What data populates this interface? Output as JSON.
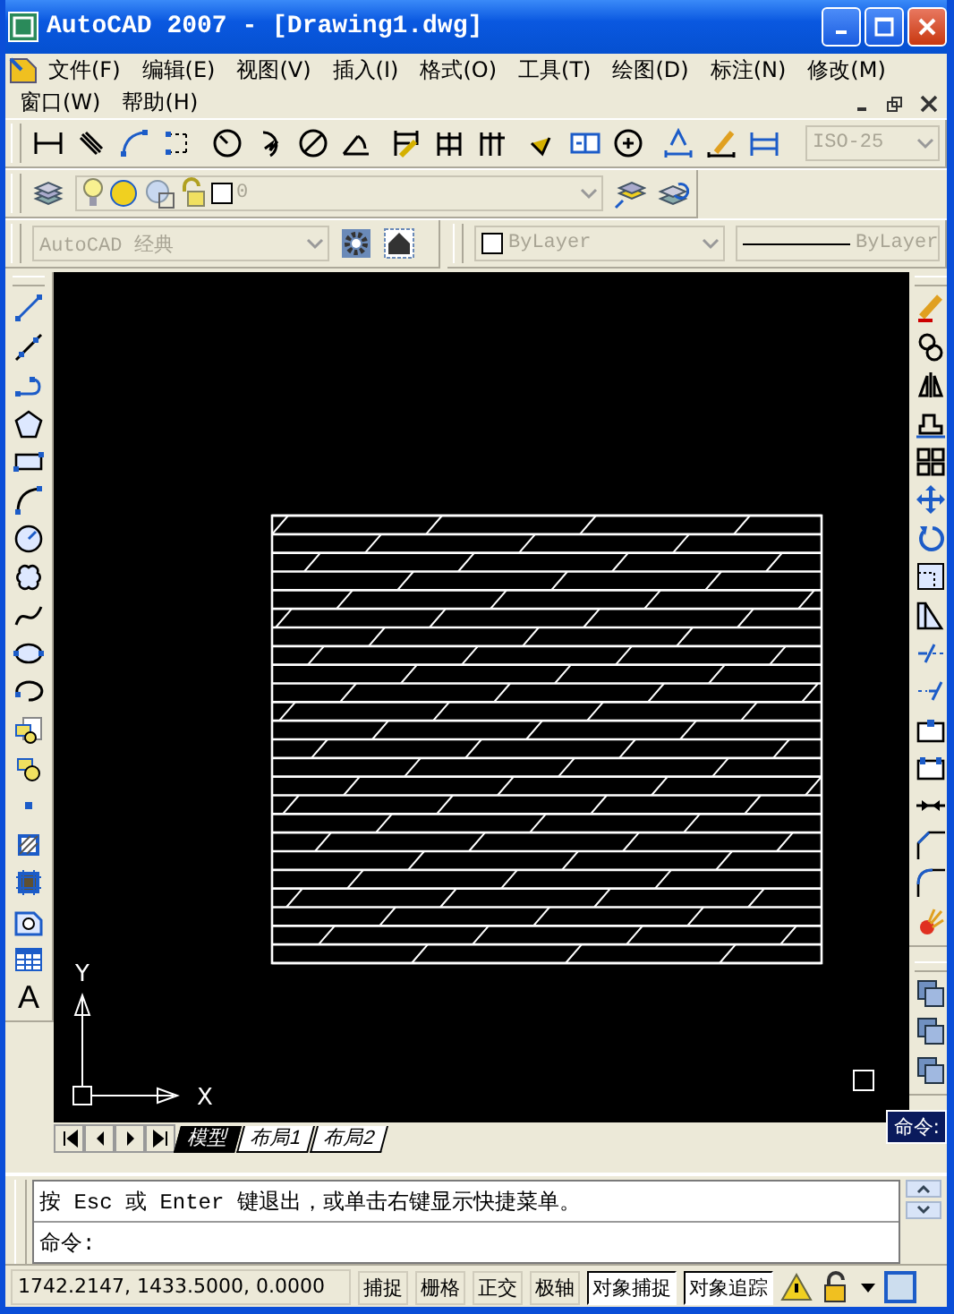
{
  "window": {
    "title": "AutoCAD 2007 - [Drawing1.dwg]"
  },
  "menu": [
    "文件(F)",
    "编辑(E)",
    "视图(V)",
    "插入(I)",
    "格式(O)",
    "工具(T)",
    "绘图(D)",
    "标注(N)",
    "修改(M)",
    "窗口(W)",
    "帮助(H)"
  ],
  "dimension_style": "ISO-25",
  "layer": "0",
  "workspace": "AutoCAD 经典",
  "color_control": "ByLayer",
  "linetype": "ByLayer",
  "text_tool": "A",
  "ucs": {
    "x_label": "X",
    "y_label": "Y"
  },
  "layout_tabs": [
    {
      "label": "模型",
      "selected": true
    },
    {
      "label": "布局1",
      "selected": false
    },
    {
      "label": "布局2",
      "selected": false
    }
  ],
  "command_tooltip": "命令:",
  "command_history": "按 Esc 或 Enter 键退出，或单击右键显示快捷菜单。",
  "command_prompt": "命令:",
  "status_bar": {
    "coordinates": "1742.2147, 1433.5000, 0.0000",
    "toggles": [
      {
        "label": "捕捉",
        "on": false
      },
      {
        "label": "栅格",
        "on": false
      },
      {
        "label": "正交",
        "on": false
      },
      {
        "label": "极轴",
        "on": false
      },
      {
        "label": "对象捕捉",
        "on": true
      },
      {
        "label": "对象追踪",
        "on": true
      }
    ]
  }
}
